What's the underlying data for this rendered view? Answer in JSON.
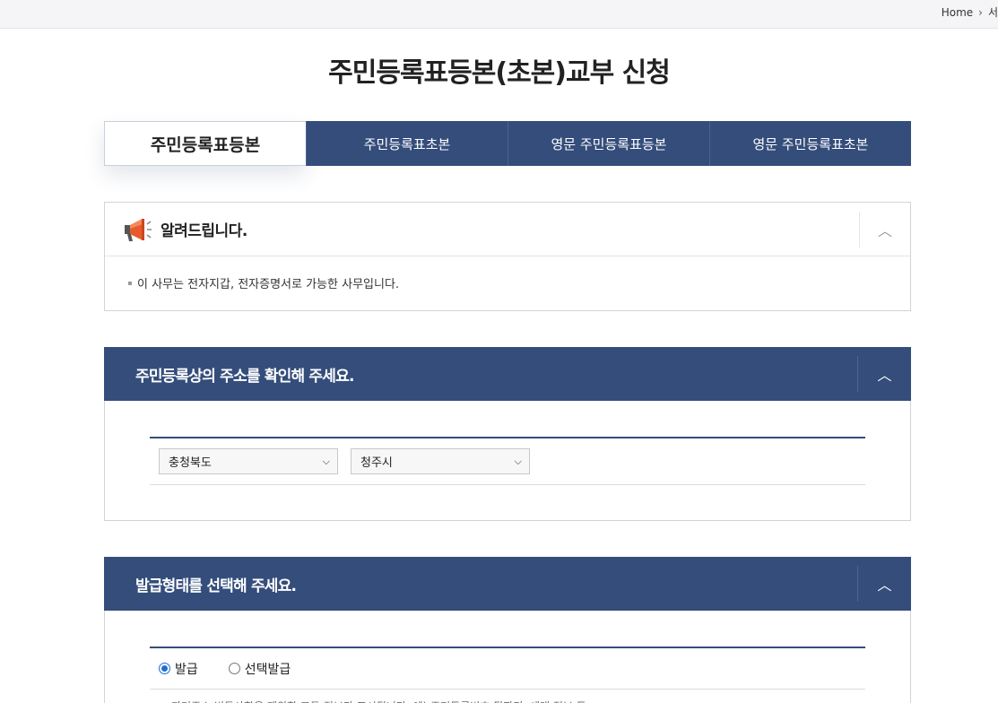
{
  "breadcrumb": {
    "home": "Home",
    "separator": "›",
    "next": "서"
  },
  "page_title": "주민등록표등본(초본)교부 신청",
  "tabs": [
    {
      "label": "주민등록표등본",
      "active": true
    },
    {
      "label": "주민등록표초본",
      "active": false
    },
    {
      "label": "영문 주민등록표등본",
      "active": false
    },
    {
      "label": "영문 주민등록표초본",
      "active": false
    }
  ],
  "notice": {
    "icon": "megaphone-icon",
    "title": "알려드립니다.",
    "toggle": "︿",
    "message": "이 사무는 전자지갑, 전자증명서로 가능한 사무입니다."
  },
  "address_section": {
    "title": "주민등록상의 주소를 확인해 주세요.",
    "toggle": "︿",
    "province_value": "충청북도",
    "city_value": "청주시"
  },
  "issue_section": {
    "title": "발급형태를 선택해 주세요.",
    "toggle": "︿",
    "options": [
      {
        "label": "발급",
        "selected": true
      },
      {
        "label": "선택발급",
        "selected": false
      }
    ],
    "cut_text": "과거주소 변동사항을 제외한 모든 정보가 표시됩니다. 예) 주민등록번호 뒷자리, 세대 정보 등"
  },
  "colors": {
    "primary": "#344d7b",
    "accent": "#1f6fd1",
    "megaphone": "#e85a2a"
  }
}
